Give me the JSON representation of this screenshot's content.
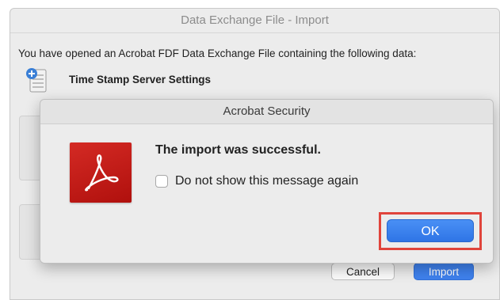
{
  "import_window": {
    "title": "Data Exchange File - Import",
    "intro": "You have opened an Acrobat FDF Data Exchange File containing the following data:",
    "data_item": "Time Stamp Server Settings",
    "cancel_label": "Cancel",
    "import_label": "Import"
  },
  "security_dialog": {
    "title": "Acrobat Security",
    "message": "The import was successful.",
    "checkbox_label": "Do not show this message again",
    "checkbox_checked": false,
    "ok_label": "OK",
    "logo_icon": "acrobat-logo-icon"
  },
  "colors": {
    "accent": "#3f82ee",
    "highlight_border": "#e0443b",
    "acrobat_red": "#c41c17"
  }
}
